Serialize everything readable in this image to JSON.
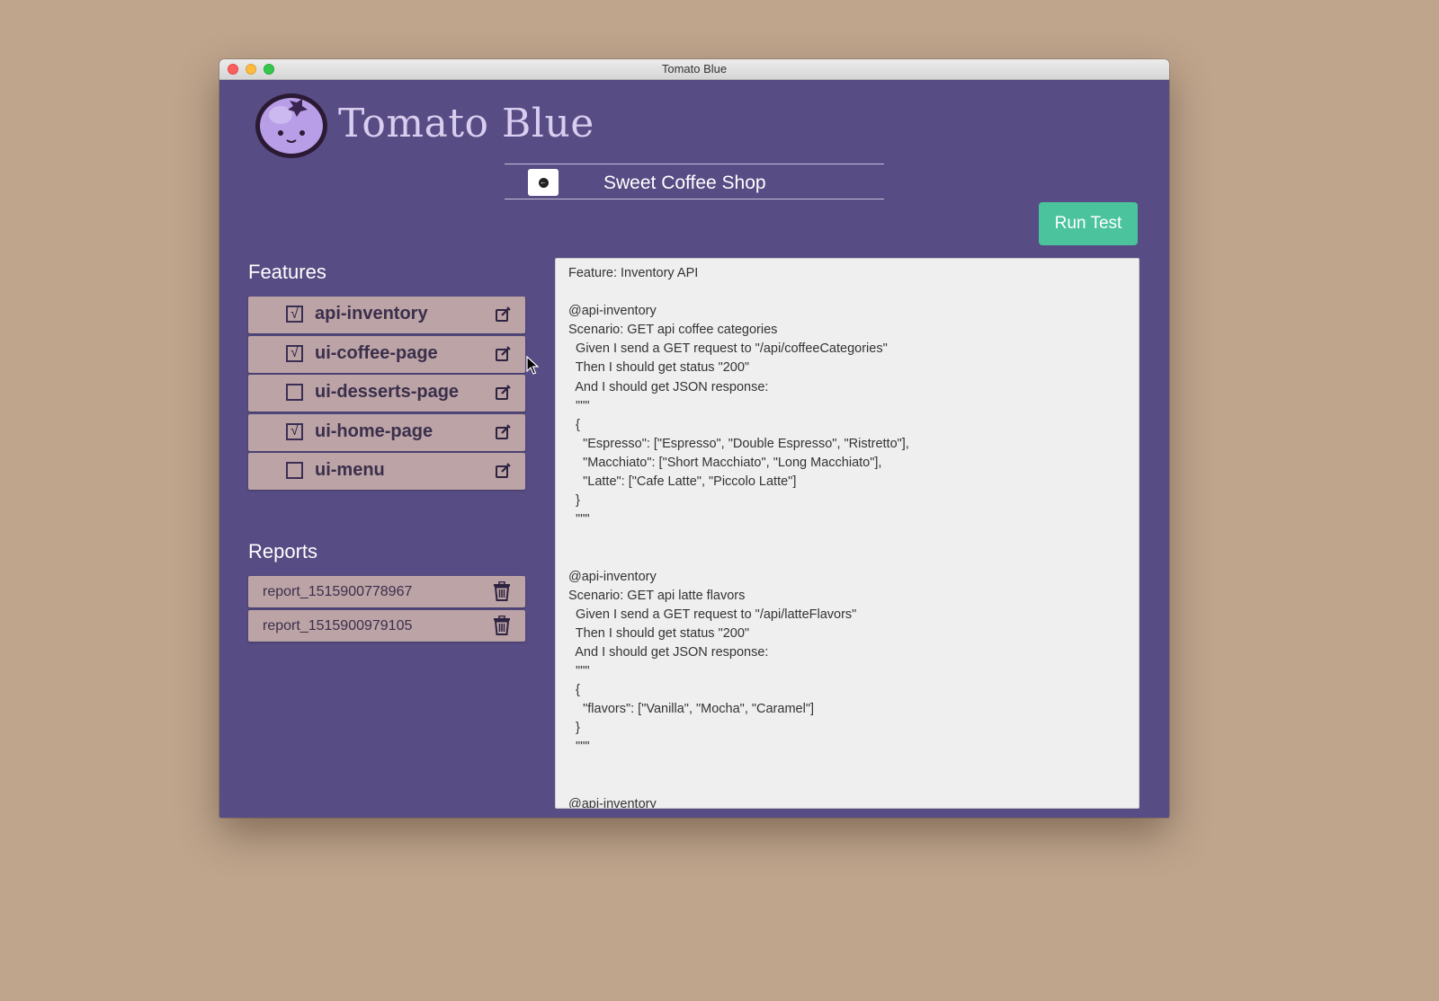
{
  "window": {
    "title": "Tomato Blue"
  },
  "header": {
    "app_name": "Tomato Blue",
    "logo_icon": "tomato-blue-mascot-icon"
  },
  "project": {
    "name": "Sweet Coffee Shop",
    "back_icon": "back-arrow-icon"
  },
  "toolbar": {
    "run_label": "Run Test"
  },
  "colors": {
    "background": "#574c83",
    "accent": "#4bc39d",
    "item": "#bca3a5",
    "desktop": "#bfa58c"
  },
  "features": {
    "title": "Features",
    "check_glyph": "√",
    "items": [
      {
        "label": "api-inventory",
        "checked": true
      },
      {
        "label": "ui-coffee-page",
        "checked": true
      },
      {
        "label": "ui-desserts-page",
        "checked": false
      },
      {
        "label": "ui-home-page",
        "checked": true
      },
      {
        "label": "ui-menu",
        "checked": false
      }
    ]
  },
  "reports": {
    "title": "Reports",
    "items": [
      {
        "label": "report_1515900778967"
      },
      {
        "label": "report_1515900979105"
      }
    ]
  },
  "editor": {
    "content": "Feature: Inventory API\n\n@api-inventory\nScenario: GET api coffee categories\n  Given I send a GET request to \"/api/coffeeCategories\"\n  Then I should get status \"200\"\n  And I should get JSON response:\n  \"\"\"\n  {\n    \"Espresso\": [\"Espresso\", \"Double Espresso\", \"Ristretto\"],\n    \"Macchiato\": [\"Short Macchiato\", \"Long Macchiato\"],\n    \"Latte\": [\"Cafe Latte\", \"Piccolo Latte\"]\n  }\n  \"\"\"\n\n\n@api-inventory\nScenario: GET api latte flavors\n  Given I send a GET request to \"/api/latteFlavors\"\n  Then I should get status \"200\"\n  And I should get JSON response:\n  \"\"\"\n  {\n    \"flavors\": [\"Vanilla\", \"Mocha\", \"Caramel\"]\n  }\n  \"\"\"\n\n\n@api-inventory\nScenario: POST api latte flavors\n  When I send a POST request to \"/api/latteFlavors\" with:"
  }
}
